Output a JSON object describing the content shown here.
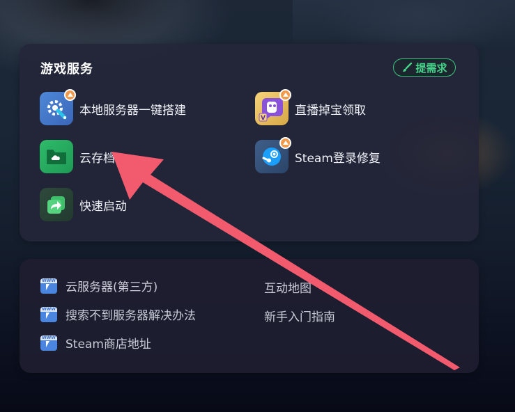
{
  "services_card": {
    "title": "游戏服务",
    "request_button": "提需求",
    "items": [
      {
        "label": "本地服务器一键搭建",
        "icon": "server-gear-icon",
        "badge": true
      },
      {
        "label": "直播掉宝领取",
        "icon": "live-drop-icon",
        "badge": true
      },
      {
        "label": "云存档",
        "icon": "cloud-save-icon",
        "badge": false
      },
      {
        "label": "Steam登录修复",
        "icon": "steam-icon",
        "badge": true
      },
      {
        "label": "快速启动",
        "icon": "quick-launch-icon",
        "badge": false
      }
    ]
  },
  "links_card": {
    "left_links": [
      {
        "label": "云服务器(第三方)",
        "icon": "www-icon"
      },
      {
        "label": "搜索不到服务器解决办法",
        "icon": "www-icon"
      },
      {
        "label": "Steam商店地址",
        "icon": "www-icon"
      }
    ],
    "right_links": [
      {
        "label": "互动地图"
      },
      {
        "label": "新手入门指南"
      }
    ],
    "www_text": "WWW"
  },
  "colors": {
    "accent_green": "#3ac47d",
    "badge_orange": "#f29a4b",
    "annotation_arrow": "#f25a6e"
  }
}
